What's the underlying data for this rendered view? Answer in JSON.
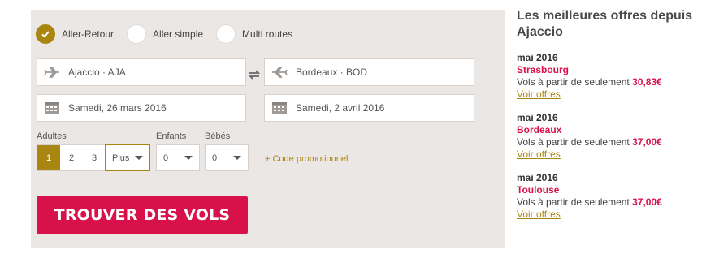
{
  "trip_types": [
    {
      "label": "Aller-Retour",
      "checked": true
    },
    {
      "label": "Aller simple",
      "checked": false
    },
    {
      "label": "Multi routes",
      "checked": false
    }
  ],
  "origin": {
    "value": "Ajaccio · AJA"
  },
  "destination": {
    "value": "Bordeaux · BOD"
  },
  "depart_date": {
    "value": "Samedi, 26 mars 2016"
  },
  "return_date": {
    "value": "Samedi, 2 avril 2016"
  },
  "passengers": {
    "adults_label": "Adultes",
    "children_label": "Enfants",
    "infants_label": "Bébés",
    "adult_options": [
      "1",
      "2",
      "3"
    ],
    "adult_selected": "1",
    "adult_more": "Plus",
    "children_value": "0",
    "infants_value": "0"
  },
  "promo_link": "+ Code promotionnel",
  "search_button": "TROUVER DES VOLS",
  "offers": {
    "title": "Les meilleures offres depuis Ajaccio",
    "items": [
      {
        "month": "mai 2016",
        "city": "Strasbourg",
        "prefix": "Vols à partir de seulement",
        "price": "30,83€",
        "link": "Voir offres"
      },
      {
        "month": "mai 2016",
        "city": "Bordeaux",
        "prefix": "Vols à partir de seulement",
        "price": "37,00€",
        "link": "Voir offres"
      },
      {
        "month": "mai 2016",
        "city": "Toulouse",
        "prefix": "Vols à partir de seulement",
        "price": "37,00€",
        "link": "Voir offres"
      }
    ]
  },
  "colors": {
    "accent": "#a8860f",
    "brand": "#d9114b",
    "panel": "#ebe7e4"
  }
}
